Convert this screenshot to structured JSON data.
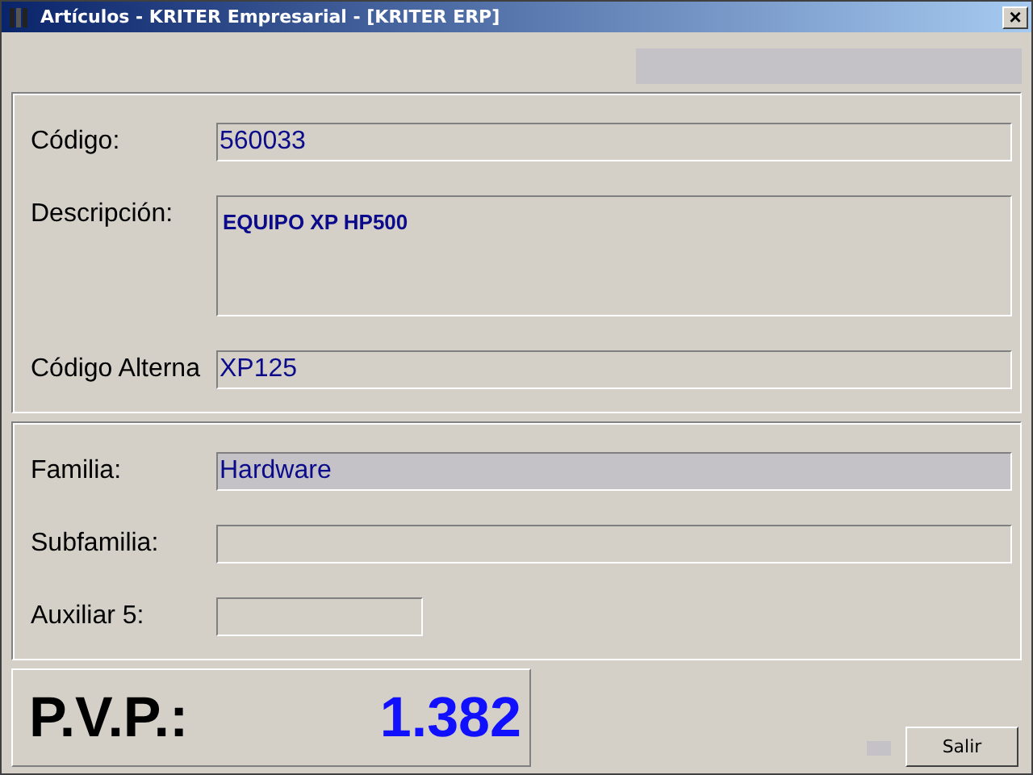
{
  "window": {
    "title": "Artículos - KRITER Empresarial - [KRITER ERP]",
    "close": "×"
  },
  "sections": [
    {
      "fields": [
        {
          "label": "Código:",
          "value": "560033",
          "kind": "line",
          "focused": false
        },
        {
          "label": "Descripción:",
          "value": "EQUIPO XP HP500",
          "kind": "memo",
          "focused": false
        },
        {
          "label": "Código Alterna",
          "value": "XP125",
          "kind": "line",
          "focused": false
        }
      ]
    },
    {
      "fields": [
        {
          "label": "Familia:",
          "value": "Hardware",
          "kind": "line",
          "focused": true
        },
        {
          "label": "Subfamilia:",
          "kind": "line",
          "focused": false
        },
        {
          "label": "Auxiliar 5:",
          "kind": "short",
          "focused": false
        }
      ]
    }
  ],
  "price": {
    "label": "P.V.P.:",
    "value": "1.382"
  },
  "buttons": [
    "Salir"
  ]
}
